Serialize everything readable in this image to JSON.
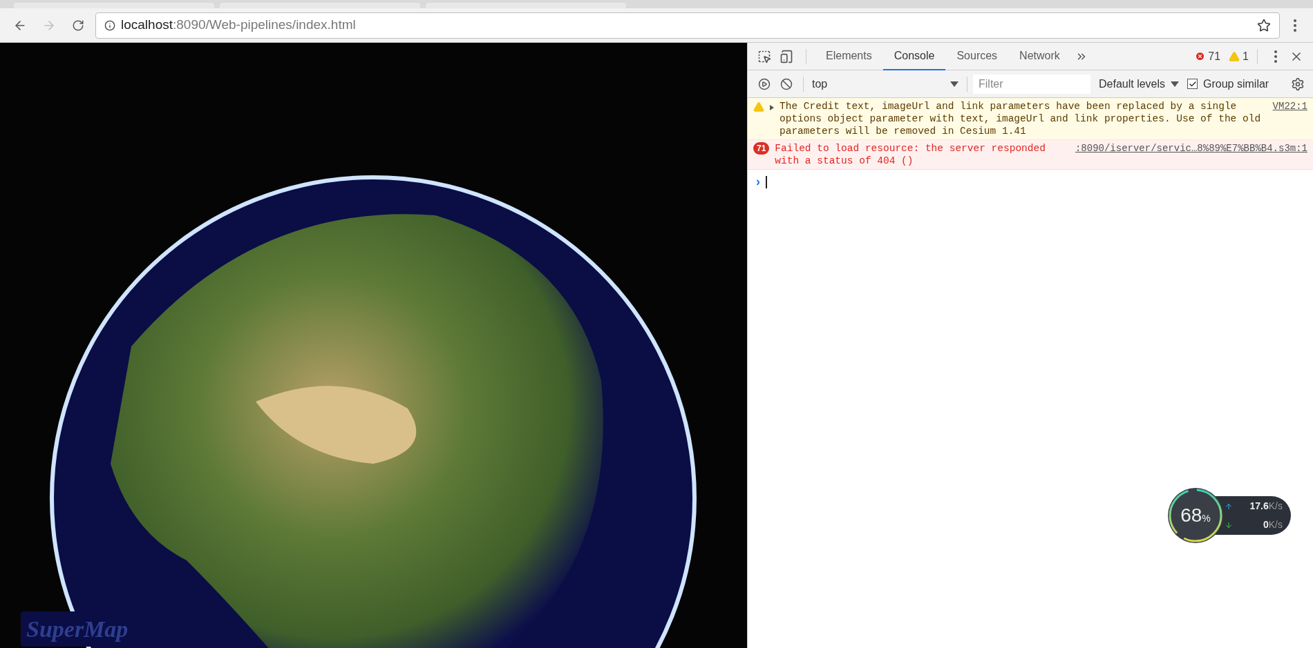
{
  "address_bar": {
    "host": "localhost",
    "path": ":8090/Web-pipelines/index.html"
  },
  "viewer": {
    "logo": "SuperMap"
  },
  "devtools": {
    "tabs": [
      {
        "label": "Elements",
        "selected": false
      },
      {
        "label": "Console",
        "selected": true
      },
      {
        "label": "Sources",
        "selected": false
      },
      {
        "label": "Network",
        "selected": false
      }
    ],
    "error_count": "71",
    "warning_count": "1",
    "context": "top",
    "filter": {
      "placeholder": "Filter"
    },
    "levels": "Default levels",
    "group_similar": {
      "label": "Group similar",
      "checked": true
    },
    "messages": [
      {
        "kind": "warning",
        "text": "The Credit text, imageUrl and link parameters have been replaced by a single options object parameter with text, imageUrl and link properties. Use of the old parameters will be removed in Cesium 1.41",
        "source": "VM22:1"
      },
      {
        "kind": "error",
        "count": "71",
        "text": "Failed to load resource: the server responded with a status of 404 ()",
        "source": ":8090/iserver/servic…8%89%E7%BB%B4.s3m:1"
      }
    ],
    "prompt": "›"
  },
  "speed_widget": {
    "percent": "68",
    "percent_unit": "%",
    "upload": "17.6",
    "upload_unit": "K/s",
    "download": "0",
    "download_unit": "K/s"
  }
}
